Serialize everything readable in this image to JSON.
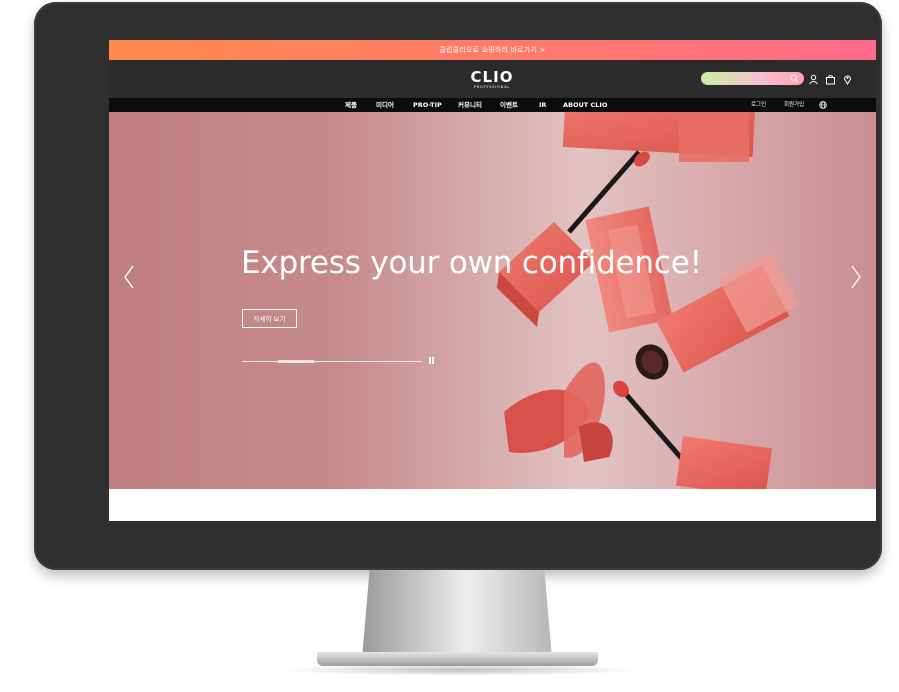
{
  "promo": {
    "text": "클럽클리오로 쇼핑하러 바로가기 >"
  },
  "brand": {
    "name": "CLIO",
    "sub": "PROFESSIONAL"
  },
  "search": {
    "value": ""
  },
  "header_icons": [
    "search-icon",
    "user-icon",
    "shopping-bag-icon",
    "location-pin-icon"
  ],
  "nav": {
    "items": [
      "제품",
      "미디어",
      "PRO-TIP",
      "커뮤니티",
      "이벤트",
      "IR",
      "ABOUT CLIO"
    ],
    "utility": [
      "로그인",
      "회원가입"
    ],
    "language_icon": "globe-icon"
  },
  "hero": {
    "headline": "Express your own confidence!",
    "cta": "자세히 보기",
    "slide_progress": 0.3,
    "prev_icon": "chevron-left-icon",
    "next_icon": "chevron-right-icon",
    "pause_icon": "pause-icon"
  },
  "colors": {
    "promo_gradient": [
      "#ff8a4c",
      "#ff6b8a"
    ],
    "header_bg": "#2b2b2b",
    "nav_bg": "#0c0c0c",
    "hero_bg": "#c78a8b",
    "product": "#e8665c"
  }
}
